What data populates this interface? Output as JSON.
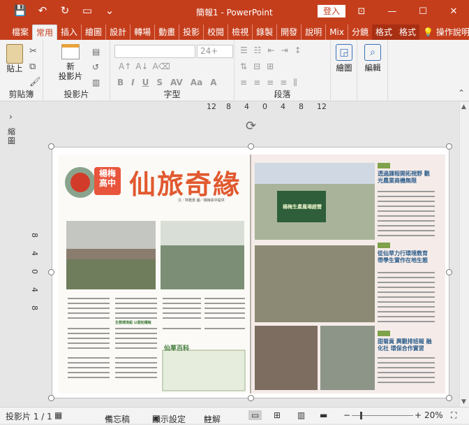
{
  "titlebar": {
    "title": "簡報1 - PowerPoint",
    "login": "登入"
  },
  "qat": {
    "save": "💾",
    "undo": "↶",
    "redo": "↻",
    "present": "▭",
    "more": "⌄"
  },
  "tabs": [
    {
      "label": "檔案"
    },
    {
      "label": "常用"
    },
    {
      "label": "插入"
    },
    {
      "label": "繪圖"
    },
    {
      "label": "設計"
    },
    {
      "label": "轉場"
    },
    {
      "label": "動畫"
    },
    {
      "label": "投影"
    },
    {
      "label": "校閱"
    },
    {
      "label": "檢視"
    },
    {
      "label": "錄製"
    },
    {
      "label": "開發"
    },
    {
      "label": "說明"
    },
    {
      "label": "Mix"
    },
    {
      "label": "分鏡"
    },
    {
      "label": "格式"
    },
    {
      "label": "格式"
    },
    {
      "label": "操作說明"
    }
  ],
  "ribbon": {
    "clipboard": {
      "label": "剪貼簿",
      "paste": "貼上"
    },
    "slides": {
      "label": "投影片",
      "new_slide_line1": "新",
      "new_slide_line2": "投影片"
    },
    "font": {
      "label": "字型",
      "size": "24+"
    },
    "paragraph": {
      "label": "段落"
    },
    "drawing": {
      "label": "繪圖"
    },
    "editing": {
      "label": "編輯"
    }
  },
  "ruler": [
    "12",
    "8",
    "4",
    "0",
    "4",
    "8",
    "12"
  ],
  "vruler": [
    "8",
    "4",
    "0",
    "4",
    "8"
  ],
  "thumbnails_label": "縮圖",
  "slide_image": {
    "left_title": "仙旅奇緣",
    "left_badge": "楊梅高中",
    "left_caption": "文／林雅惠 圖／楊梅高中提供",
    "left_section1": "生態環境組 以開拓種植",
    "left_section2": "仙草百科",
    "right_heading1": "透過課程開拓視野 觀光農業商機無限",
    "right_heading2": "從仙草力行環境教育 帶學生實作在地生態",
    "right_heading3": "甜菊貢 興觀排班報 融化社 環保合作實習",
    "banner": "楊梅生產農場經營"
  },
  "status": {
    "slide": "投影片 1 / 1",
    "notes": "備忘稿",
    "display": "顯示設定",
    "comments": "註解",
    "zoom": "20%"
  }
}
